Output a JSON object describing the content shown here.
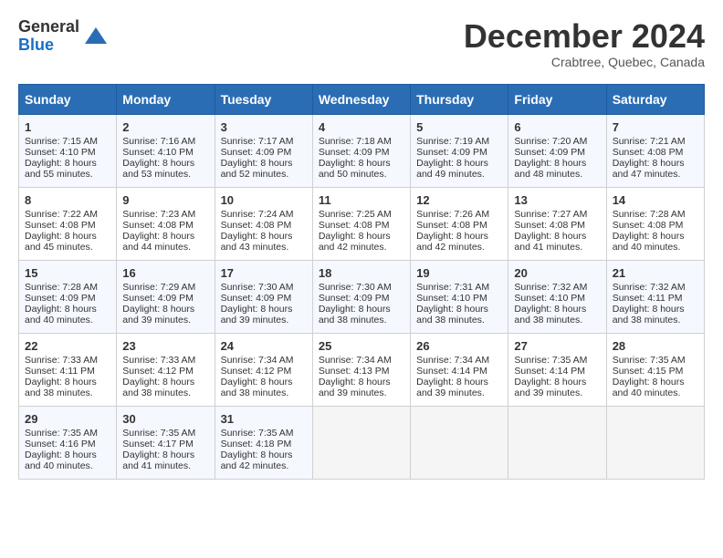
{
  "logo": {
    "general": "General",
    "blue": "Blue"
  },
  "title": "December 2024",
  "subtitle": "Crabtree, Quebec, Canada",
  "days_of_week": [
    "Sunday",
    "Monday",
    "Tuesday",
    "Wednesday",
    "Thursday",
    "Friday",
    "Saturday"
  ],
  "weeks": [
    [
      {
        "day": "1",
        "sunrise": "7:15 AM",
        "sunset": "4:10 PM",
        "daylight": "8 hours and 55 minutes."
      },
      {
        "day": "2",
        "sunrise": "7:16 AM",
        "sunset": "4:10 PM",
        "daylight": "8 hours and 53 minutes."
      },
      {
        "day": "3",
        "sunrise": "7:17 AM",
        "sunset": "4:09 PM",
        "daylight": "8 hours and 52 minutes."
      },
      {
        "day": "4",
        "sunrise": "7:18 AM",
        "sunset": "4:09 PM",
        "daylight": "8 hours and 50 minutes."
      },
      {
        "day": "5",
        "sunrise": "7:19 AM",
        "sunset": "4:09 PM",
        "daylight": "8 hours and 49 minutes."
      },
      {
        "day": "6",
        "sunrise": "7:20 AM",
        "sunset": "4:09 PM",
        "daylight": "8 hours and 48 minutes."
      },
      {
        "day": "7",
        "sunrise": "7:21 AM",
        "sunset": "4:08 PM",
        "daylight": "8 hours and 47 minutes."
      }
    ],
    [
      {
        "day": "8",
        "sunrise": "7:22 AM",
        "sunset": "4:08 PM",
        "daylight": "8 hours and 45 minutes."
      },
      {
        "day": "9",
        "sunrise": "7:23 AM",
        "sunset": "4:08 PM",
        "daylight": "8 hours and 44 minutes."
      },
      {
        "day": "10",
        "sunrise": "7:24 AM",
        "sunset": "4:08 PM",
        "daylight": "8 hours and 43 minutes."
      },
      {
        "day": "11",
        "sunrise": "7:25 AM",
        "sunset": "4:08 PM",
        "daylight": "8 hours and 42 minutes."
      },
      {
        "day": "12",
        "sunrise": "7:26 AM",
        "sunset": "4:08 PM",
        "daylight": "8 hours and 42 minutes."
      },
      {
        "day": "13",
        "sunrise": "7:27 AM",
        "sunset": "4:08 PM",
        "daylight": "8 hours and 41 minutes."
      },
      {
        "day": "14",
        "sunrise": "7:28 AM",
        "sunset": "4:08 PM",
        "daylight": "8 hours and 40 minutes."
      }
    ],
    [
      {
        "day": "15",
        "sunrise": "7:28 AM",
        "sunset": "4:09 PM",
        "daylight": "8 hours and 40 minutes."
      },
      {
        "day": "16",
        "sunrise": "7:29 AM",
        "sunset": "4:09 PM",
        "daylight": "8 hours and 39 minutes."
      },
      {
        "day": "17",
        "sunrise": "7:30 AM",
        "sunset": "4:09 PM",
        "daylight": "8 hours and 39 minutes."
      },
      {
        "day": "18",
        "sunrise": "7:30 AM",
        "sunset": "4:09 PM",
        "daylight": "8 hours and 38 minutes."
      },
      {
        "day": "19",
        "sunrise": "7:31 AM",
        "sunset": "4:10 PM",
        "daylight": "8 hours and 38 minutes."
      },
      {
        "day": "20",
        "sunrise": "7:32 AM",
        "sunset": "4:10 PM",
        "daylight": "8 hours and 38 minutes."
      },
      {
        "day": "21",
        "sunrise": "7:32 AM",
        "sunset": "4:11 PM",
        "daylight": "8 hours and 38 minutes."
      }
    ],
    [
      {
        "day": "22",
        "sunrise": "7:33 AM",
        "sunset": "4:11 PM",
        "daylight": "8 hours and 38 minutes."
      },
      {
        "day": "23",
        "sunrise": "7:33 AM",
        "sunset": "4:12 PM",
        "daylight": "8 hours and 38 minutes."
      },
      {
        "day": "24",
        "sunrise": "7:34 AM",
        "sunset": "4:12 PM",
        "daylight": "8 hours and 38 minutes."
      },
      {
        "day": "25",
        "sunrise": "7:34 AM",
        "sunset": "4:13 PM",
        "daylight": "8 hours and 39 minutes."
      },
      {
        "day": "26",
        "sunrise": "7:34 AM",
        "sunset": "4:14 PM",
        "daylight": "8 hours and 39 minutes."
      },
      {
        "day": "27",
        "sunrise": "7:35 AM",
        "sunset": "4:14 PM",
        "daylight": "8 hours and 39 minutes."
      },
      {
        "day": "28",
        "sunrise": "7:35 AM",
        "sunset": "4:15 PM",
        "daylight": "8 hours and 40 minutes."
      }
    ],
    [
      {
        "day": "29",
        "sunrise": "7:35 AM",
        "sunset": "4:16 PM",
        "daylight": "8 hours and 40 minutes."
      },
      {
        "day": "30",
        "sunrise": "7:35 AM",
        "sunset": "4:17 PM",
        "daylight": "8 hours and 41 minutes."
      },
      {
        "day": "31",
        "sunrise": "7:35 AM",
        "sunset": "4:18 PM",
        "daylight": "8 hours and 42 minutes."
      },
      null,
      null,
      null,
      null
    ]
  ],
  "labels": {
    "sunrise": "Sunrise:",
    "sunset": "Sunset:",
    "daylight": "Daylight:"
  }
}
